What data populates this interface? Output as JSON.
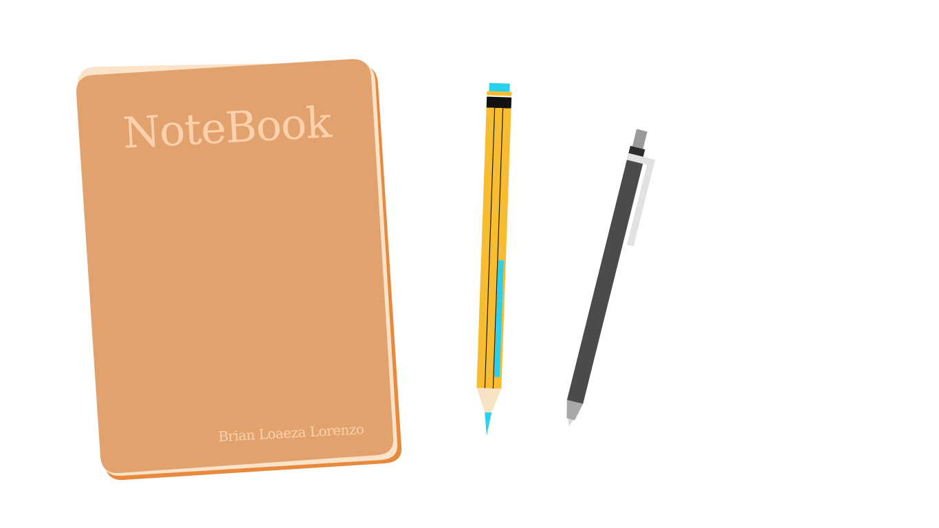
{
  "notebook": {
    "title": "NoteBook",
    "author": "Brian Loaeza Lorenzo"
  },
  "colors": {
    "background": "#ffffff",
    "notebook_cover": "#e2a26e",
    "notebook_page_edge": "#fbe3c9",
    "notebook_back": "#e88a3e",
    "cover_text": "#fcd1ac",
    "pencil_body": "#f8bc30",
    "pencil_stripe": "#1a1a1a",
    "pencil_ferrule": "#111111",
    "pencil_eraser": "#2ad1ee",
    "pencil_wood": "#f8e4c4",
    "pencil_lead": "#2ad1ee",
    "pen_body": "#4b4b4b",
    "pen_clip": "#e2e2e2",
    "pen_button": "#9a9a9a",
    "pen_tip": "#a8a8a8"
  },
  "icons": [
    "notebook-icon",
    "pencil-icon",
    "pen-icon"
  ]
}
